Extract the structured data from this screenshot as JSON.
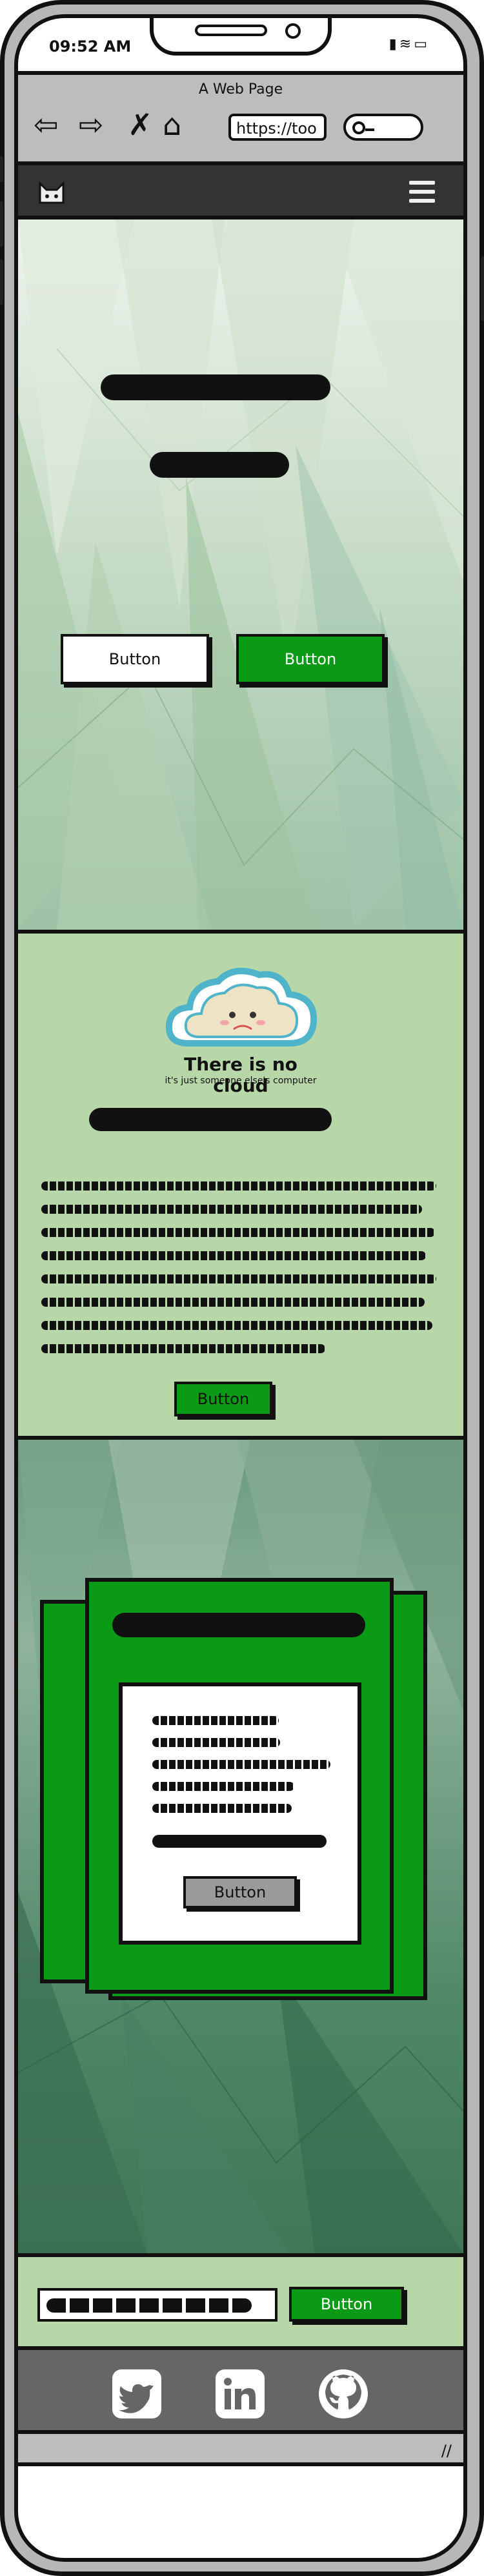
{
  "status_bar": {
    "time": "09:52 AM",
    "icons": [
      "signal-icon",
      "wifi-icon",
      "battery-icon"
    ]
  },
  "browser": {
    "title": "A Web Page",
    "url": "https://too",
    "nav_icons": [
      "back-arrow-icon",
      "forward-arrow-icon",
      "stop-icon",
      "home-icon"
    ]
  },
  "site": {
    "header": {
      "logo_icon": "cat-logo-icon",
      "menu_icon": "hamburger-menu-icon"
    },
    "hero": {
      "buttons": {
        "secondary": "Button",
        "primary": "Button"
      }
    },
    "feature": {
      "cloud_title": "There is no cloud",
      "cloud_subtitle": "it's just someone else's computer",
      "button": "Button"
    },
    "card": {
      "button": "Button"
    },
    "footer_form": {
      "submit": "Button"
    },
    "social": [
      "twitter-icon",
      "linkedin-icon",
      "github-icon"
    ]
  },
  "colors": {
    "accent_green": "#0a9a15",
    "panel_green": "#b7d7a8",
    "header_dark": "#333333",
    "social_bar": "#666666"
  }
}
